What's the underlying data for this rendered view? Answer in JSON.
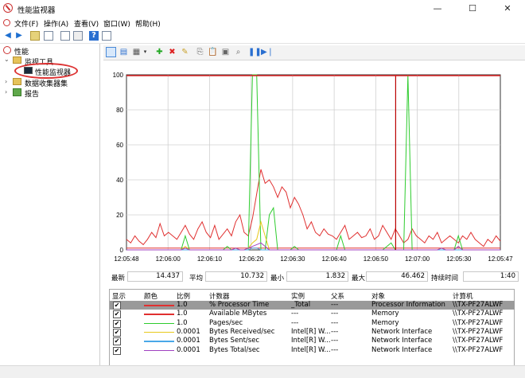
{
  "window": {
    "title": "性能监视器",
    "controls": [
      "—",
      "☐",
      "✕"
    ]
  },
  "menu": [
    "文件(F)",
    "操作(A)",
    "查看(V)",
    "窗口(W)",
    "帮助(H)"
  ],
  "tree": {
    "root": "性能",
    "tools": "监视工具",
    "perfmon": "性能监视器",
    "collector": "数据收集器集",
    "reports": "报告"
  },
  "stats": {
    "last_label": "最新",
    "last": "14.437",
    "avg_label": "平均",
    "avg": "10.732",
    "min_label": "最小",
    "min": "1.832",
    "max_label": "最大",
    "max": "46.462",
    "duration_label": "持续时间",
    "duration": "1:40"
  },
  "legend": {
    "headers": [
      "显示",
      "颜色",
      "比例",
      "计数器",
      "实例",
      "父系",
      "对象",
      "计算机"
    ],
    "rows": [
      {
        "show": "✔",
        "color": "#e03030",
        "scale": "1.0",
        "counter": "% Processor Time",
        "instance": "_Total",
        "parent": "---",
        "object": "Processor Information",
        "computer": "\\\\TX-PF27ALWF"
      },
      {
        "show": "✔",
        "color": "#e03030",
        "scale": "1.0",
        "counter": "Available MBytes",
        "instance": "---",
        "parent": "---",
        "object": "Memory",
        "computer": "\\\\TX-PF27ALWF"
      },
      {
        "show": "✔",
        "color": "#2ecc2e",
        "scale": "1.0",
        "counter": "Pages/sec",
        "instance": "---",
        "parent": "---",
        "object": "Memory",
        "computer": "\\\\TX-PF27ALWF"
      },
      {
        "show": "✔",
        "color": "#e8c81a",
        "scale": "0.0001",
        "counter": "Bytes Received/sec",
        "instance": "Intel[R] W...",
        "parent": "---",
        "object": "Network Interface",
        "computer": "\\\\TX-PF27ALWF"
      },
      {
        "show": "✔",
        "color": "#4aa8e8",
        "scale": "0.0001",
        "counter": "Bytes Sent/sec",
        "instance": "Intel[R] W...",
        "parent": "---",
        "object": "Network Interface",
        "computer": "\\\\TX-PF27ALWF"
      },
      {
        "show": "✔",
        "color": "#a040c0",
        "scale": "0.0001",
        "counter": "Bytes Total/sec",
        "instance": "Intel[R] W...",
        "parent": "---",
        "object": "Network Interface",
        "computer": "\\\\TX-PF27ALWF"
      }
    ]
  },
  "chart_data": {
    "type": "line",
    "ylim": [
      0,
      100
    ],
    "yticks": [
      "100",
      "80",
      "60",
      "40",
      "20",
      "0"
    ],
    "xticks": [
      "12:05:48",
      "12:06:00",
      "12:06:10",
      "12:06:20",
      "12:06:30",
      "12:06:40",
      "12:06:50",
      "12:07:00",
      "12:05:30",
      "12:05:47"
    ],
    "series": [
      {
        "name": "% Processor Time",
        "color": "#e03030",
        "values": [
          6,
          4,
          8,
          5,
          3,
          6,
          10,
          7,
          15,
          8,
          10,
          8,
          6,
          10,
          14,
          9,
          6,
          12,
          16,
          10,
          7,
          14,
          6,
          9,
          12,
          8,
          16,
          20,
          10,
          8,
          18,
          32,
          46,
          38,
          40,
          36,
          30,
          36,
          33,
          24,
          30,
          26,
          20,
          12,
          16,
          10,
          8,
          12,
          9,
          8,
          6,
          10,
          14,
          6,
          8,
          10,
          7,
          8,
          12,
          6,
          8,
          14,
          10,
          6,
          12,
          8,
          4,
          6,
          12,
          8,
          6,
          4,
          8,
          6,
          10,
          4,
          6,
          8,
          6,
          4,
          8,
          6,
          10,
          6,
          4,
          2,
          6,
          4,
          8,
          5
        ]
      },
      {
        "name": "Available MBytes",
        "color": "#e03030",
        "values": [
          1,
          1,
          1,
          1,
          1,
          1,
          1,
          1,
          1,
          1,
          1,
          1,
          1,
          1,
          1,
          1,
          1,
          1,
          1,
          1,
          1,
          1,
          1,
          1,
          1,
          1,
          1,
          1,
          1,
          1,
          1,
          1,
          1,
          1,
          1,
          1,
          1,
          1,
          1,
          1,
          1,
          1,
          1,
          1,
          1,
          1,
          1,
          1,
          1,
          1,
          1,
          1,
          1,
          1,
          1,
          1,
          1,
          1,
          1,
          1,
          1,
          1,
          1,
          1,
          1,
          1,
          1,
          1,
          1,
          1,
          1,
          1,
          1,
          1,
          1,
          1,
          1,
          1,
          1,
          1,
          1,
          1,
          1,
          1,
          1,
          1,
          1,
          1,
          1,
          1
        ]
      },
      {
        "name": "Pages/sec",
        "color": "#2ecc2e",
        "values": [
          0,
          0,
          0,
          0,
          0,
          0,
          0,
          0,
          0,
          0,
          0,
          0,
          0,
          0,
          8,
          0,
          0,
          0,
          0,
          0,
          0,
          0,
          0,
          0,
          2,
          0,
          0,
          0,
          0,
          0,
          100,
          100,
          0,
          0,
          20,
          24,
          0,
          0,
          0,
          0,
          2,
          0,
          0,
          0,
          0,
          0,
          0,
          0,
          0,
          0,
          0,
          8,
          0,
          0,
          0,
          0,
          0,
          0,
          0,
          0,
          0,
          0,
          2,
          4,
          0,
          0,
          0,
          100,
          0,
          0,
          0,
          0,
          0,
          0,
          0,
          0,
          0,
          0,
          0,
          8,
          0,
          0,
          0,
          0,
          0,
          0,
          0,
          0,
          0,
          0
        ]
      },
      {
        "name": "Bytes Received/sec",
        "color": "#e8c81a",
        "values": [
          0,
          0,
          0,
          0,
          0,
          0,
          0,
          0,
          0,
          0,
          0,
          0,
          0,
          0,
          2,
          0,
          0,
          0,
          0,
          0,
          0,
          0,
          0,
          0,
          0,
          0,
          1,
          0,
          0,
          1,
          4,
          6,
          16,
          8,
          0,
          0,
          0,
          0,
          0,
          0,
          0,
          0,
          0,
          0,
          0,
          0,
          0,
          0,
          0,
          0,
          0,
          0,
          0,
          0,
          0,
          0,
          0,
          0,
          0,
          0,
          0,
          0,
          0,
          0,
          0,
          0,
          0,
          0,
          0,
          0,
          0,
          0,
          0,
          0,
          0,
          1,
          0,
          0,
          0,
          2,
          0,
          0,
          0,
          0,
          0,
          0,
          0,
          0,
          0,
          0
        ]
      },
      {
        "name": "Bytes Sent/sec",
        "color": "#4aa8e8",
        "values": [
          0,
          0,
          0,
          0,
          0,
          0,
          0,
          0,
          0,
          0,
          0,
          0,
          0,
          0,
          0,
          0,
          0,
          0,
          0,
          0,
          0,
          0,
          0,
          0,
          0,
          0,
          0,
          0,
          0,
          0,
          1,
          1,
          0,
          0,
          0,
          0,
          0,
          0,
          0,
          0,
          0,
          0,
          0,
          0,
          0,
          0,
          0,
          0,
          0,
          0,
          0,
          0,
          0,
          0,
          0,
          0,
          0,
          0,
          0,
          0,
          0,
          0,
          0,
          0,
          0,
          0,
          0,
          0,
          0,
          0,
          0,
          0,
          0,
          0,
          0,
          0,
          0,
          0,
          0,
          0,
          0,
          0,
          0,
          0,
          0,
          0,
          0,
          0,
          0,
          0
        ]
      },
      {
        "name": "Bytes Total/sec",
        "color": "#a040c0",
        "values": [
          0,
          0,
          0,
          0,
          0,
          0,
          0,
          0,
          0,
          0,
          0,
          0,
          0,
          0,
          1,
          0,
          0,
          0,
          0,
          0,
          0,
          0,
          0,
          0,
          0,
          0,
          1,
          0,
          0,
          1,
          2,
          3,
          4,
          2,
          0,
          0,
          0,
          0,
          0,
          0,
          0,
          0,
          0,
          0,
          0,
          0,
          0,
          0,
          0,
          0,
          0,
          0,
          0,
          0,
          0,
          0,
          0,
          0,
          0,
          0,
          0,
          0,
          0,
          0,
          0,
          0,
          0,
          0,
          0,
          0,
          0,
          0,
          0,
          0,
          0,
          1,
          0,
          0,
          0,
          2,
          0,
          0,
          0,
          0,
          0,
          0,
          0,
          0,
          0,
          0
        ]
      }
    ]
  }
}
